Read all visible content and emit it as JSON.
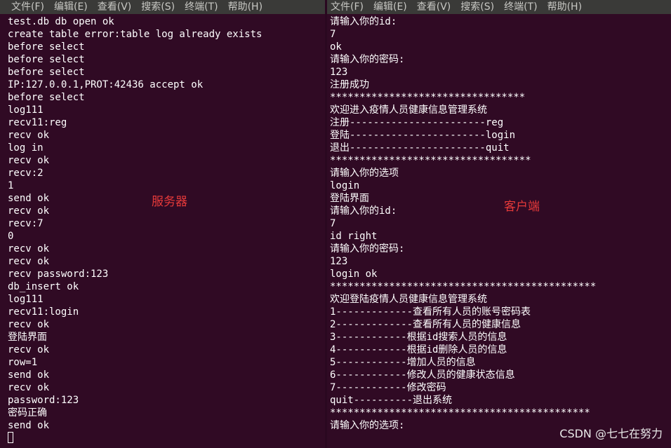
{
  "left_terminal": {
    "menu": [
      "文件(F)",
      "编辑(E)",
      "查看(V)",
      "搜索(S)",
      "终端(T)",
      "帮助(H)"
    ],
    "lines": [
      "test.db db open ok",
      "create table error:table log already exists",
      "before select",
      "before select",
      "before select",
      "IP:127.0.0.1,PROT:42436 accept ok",
      "before select",
      "log111",
      "recv11:reg",
      "recv ok",
      "log in",
      "recv ok",
      "recv:2",
      "1",
      "send ok",
      "recv ok",
      "recv:7",
      "0",
      "recv ok",
      "recv ok",
      "recv password:123",
      "db_insert ok",
      "log111",
      "recv11:login",
      "recv ok",
      "登陆界面",
      "recv ok",
      "row=1",
      "send ok",
      "recv ok",
      "password:123",
      "密码正确",
      "send ok"
    ],
    "annotation": "服务器"
  },
  "right_terminal": {
    "menu": [
      "文件(F)",
      "编辑(E)",
      "查看(V)",
      "搜索(S)",
      "终端(T)",
      "帮助(H)"
    ],
    "lines": [
      "请输入你的id:",
      "7",
      "ok",
      "请输入你的密码:",
      "123",
      "注册成功",
      "*********************************",
      "欢迎进入疫情人员健康信息管理系统",
      "注册-----------------------reg",
      "登陆-----------------------login",
      "退出-----------------------quit",
      "**********************************",
      "请输入你的选项",
      "login",
      "登陆界面",
      "请输入你的id:",
      "7",
      "id right",
      "请输入你的密码:",
      "123",
      "login ok",
      "*********************************************",
      "欢迎登陆疫情人员健康信息管理系统",
      "1-------------查看所有人员的账号密码表",
      "2-------------查看所有人员的健康信息",
      "3------------根据id搜索人员的信息",
      "4------------根据id删除人员的信息",
      "5------------增加人员的信息",
      "6------------修改人员的健康状态信息",
      "7------------修改密码",
      "quit----------退出系统",
      "********************************************",
      "请输入你的选项:"
    ],
    "annotation": "客户端"
  },
  "watermark": "CSDN @七七在努力"
}
